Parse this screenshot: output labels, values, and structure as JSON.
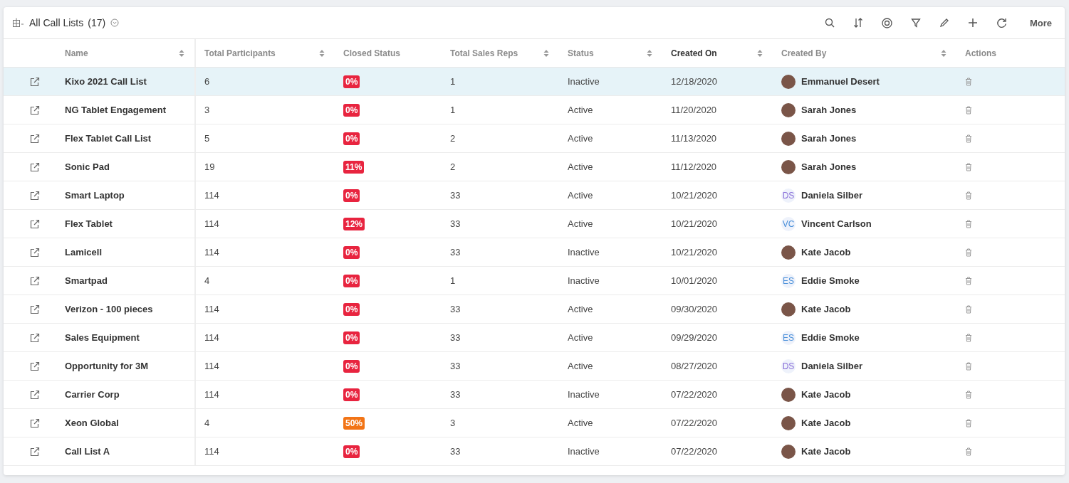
{
  "header": {
    "title": "All Call Lists",
    "count": "(17)",
    "toolbar_more": "More"
  },
  "columns": [
    {
      "label": "Name",
      "sortable": true,
      "sorted": false
    },
    {
      "label": "Total Participants",
      "sortable": true,
      "sorted": false
    },
    {
      "label": "Closed Status",
      "sortable": false,
      "sorted": false
    },
    {
      "label": "Total Sales Reps",
      "sortable": true,
      "sorted": false
    },
    {
      "label": "Status",
      "sortable": true,
      "sorted": false
    },
    {
      "label": "Created On",
      "sortable": true,
      "sorted": true
    },
    {
      "label": "Created By",
      "sortable": true,
      "sorted": false
    },
    {
      "label": "Actions",
      "sortable": false,
      "sorted": false
    }
  ],
  "rows": [
    {
      "selected": true,
      "name": "Kixo 2021 Call List",
      "participants": "6",
      "closed": {
        "text": "0%",
        "color": "#e8243f"
      },
      "reps": "1",
      "status": "Inactive",
      "created_on": "12/18/2020",
      "creator": {
        "name": "Emmanuel Desert",
        "kind": "photo"
      }
    },
    {
      "selected": false,
      "name": "NG Tablet Engagement",
      "participants": "3",
      "closed": {
        "text": "0%",
        "color": "#e8243f"
      },
      "reps": "1",
      "status": "Active",
      "created_on": "11/20/2020",
      "creator": {
        "name": "Sarah Jones",
        "kind": "photo"
      }
    },
    {
      "selected": false,
      "name": "Flex Tablet Call List",
      "participants": "5",
      "closed": {
        "text": "0%",
        "color": "#e8243f"
      },
      "reps": "2",
      "status": "Active",
      "created_on": "11/13/2020",
      "creator": {
        "name": "Sarah Jones",
        "kind": "photo"
      }
    },
    {
      "selected": false,
      "name": "Sonic Pad",
      "participants": "19",
      "closed": {
        "text": "11%",
        "color": "#e8243f"
      },
      "reps": "2",
      "status": "Active",
      "created_on": "11/12/2020",
      "creator": {
        "name": "Sarah Jones",
        "kind": "photo"
      }
    },
    {
      "selected": false,
      "name": "Smart Laptop",
      "participants": "114",
      "closed": {
        "text": "0%",
        "color": "#e8243f"
      },
      "reps": "33",
      "status": "Active",
      "created_on": "10/21/2020",
      "creator": {
        "name": "Daniela Silber",
        "kind": "initials",
        "initials": "DS",
        "color": "#8a6fd8"
      }
    },
    {
      "selected": false,
      "name": "Flex Tablet",
      "participants": "114",
      "closed": {
        "text": "12%",
        "color": "#e8243f"
      },
      "reps": "33",
      "status": "Active",
      "created_on": "10/21/2020",
      "creator": {
        "name": "Vincent Carlson",
        "kind": "initials",
        "initials": "VC",
        "color": "#4a90d9"
      }
    },
    {
      "selected": false,
      "name": "Lamicell",
      "participants": "114",
      "closed": {
        "text": "0%",
        "color": "#e8243f"
      },
      "reps": "33",
      "status": "Inactive",
      "created_on": "10/21/2020",
      "creator": {
        "name": "Kate Jacob",
        "kind": "photo"
      }
    },
    {
      "selected": false,
      "name": "Smartpad",
      "participants": "4",
      "closed": {
        "text": "0%",
        "color": "#e8243f"
      },
      "reps": "1",
      "status": "Inactive",
      "created_on": "10/01/2020",
      "creator": {
        "name": "Eddie Smoke",
        "kind": "initials",
        "initials": "ES",
        "color": "#4a90d9"
      }
    },
    {
      "selected": false,
      "name": "Verizon - 100 pieces",
      "participants": "114",
      "closed": {
        "text": "0%",
        "color": "#e8243f"
      },
      "reps": "33",
      "status": "Active",
      "created_on": "09/30/2020",
      "creator": {
        "name": "Kate Jacob",
        "kind": "photo"
      }
    },
    {
      "selected": false,
      "name": "Sales Equipment",
      "participants": "114",
      "closed": {
        "text": "0%",
        "color": "#e8243f"
      },
      "reps": "33",
      "status": "Active",
      "created_on": "09/29/2020",
      "creator": {
        "name": "Eddie Smoke",
        "kind": "initials",
        "initials": "ES",
        "color": "#4a90d9"
      }
    },
    {
      "selected": false,
      "name": "Opportunity for 3M",
      "participants": "114",
      "closed": {
        "text": "0%",
        "color": "#e8243f"
      },
      "reps": "33",
      "status": "Active",
      "created_on": "08/27/2020",
      "creator": {
        "name": "Daniela Silber",
        "kind": "initials",
        "initials": "DS",
        "color": "#8a6fd8"
      }
    },
    {
      "selected": false,
      "name": "Carrier Corp",
      "participants": "114",
      "closed": {
        "text": "0%",
        "color": "#e8243f"
      },
      "reps": "33",
      "status": "Inactive",
      "created_on": "07/22/2020",
      "creator": {
        "name": "Kate Jacob",
        "kind": "photo"
      }
    },
    {
      "selected": false,
      "name": "Xeon Global",
      "participants": "4",
      "closed": {
        "text": "50%",
        "color": "#f27416"
      },
      "reps": "3",
      "status": "Active",
      "created_on": "07/22/2020",
      "creator": {
        "name": "Kate Jacob",
        "kind": "photo"
      }
    },
    {
      "selected": false,
      "name": "Call List A",
      "participants": "114",
      "closed": {
        "text": "0%",
        "color": "#e8243f"
      },
      "reps": "33",
      "status": "Inactive",
      "created_on": "07/22/2020",
      "creator": {
        "name": "Kate Jacob",
        "kind": "photo"
      }
    }
  ]
}
